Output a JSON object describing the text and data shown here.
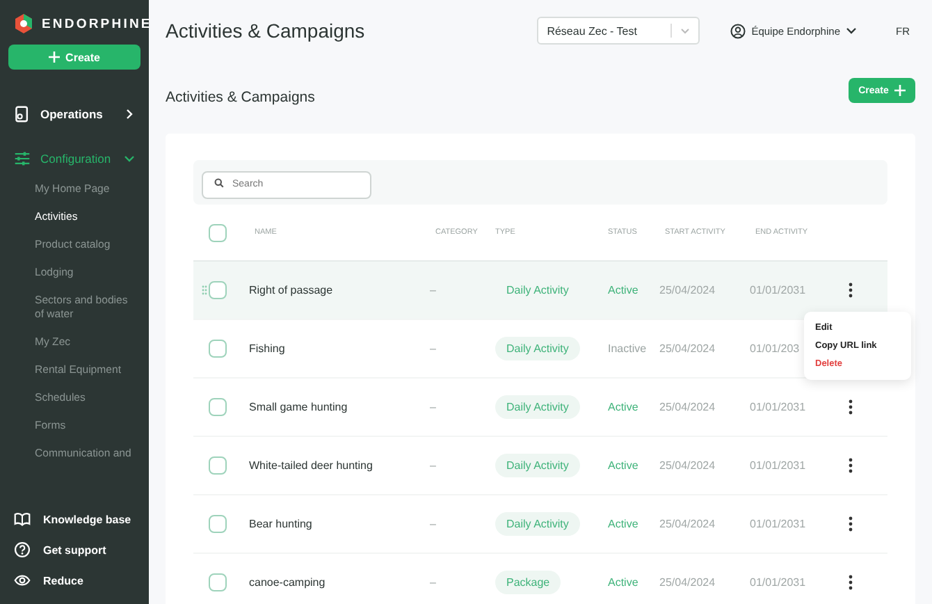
{
  "sidebar": {
    "brand": "ENDORPHINE",
    "create_button": "Create",
    "sections": [
      {
        "label": "Operations",
        "expanded": false
      },
      {
        "label": "Configuration",
        "expanded": true,
        "children": [
          {
            "label": "My Home Page",
            "selected": false
          },
          {
            "label": "Activities",
            "selected": true
          },
          {
            "label": "Product catalog",
            "selected": false
          },
          {
            "label": "Lodging",
            "selected": false
          },
          {
            "label": "Sectors and bodies of water",
            "selected": false
          },
          {
            "label": "My Zec",
            "selected": false
          },
          {
            "label": "Rental Equipment",
            "selected": false
          },
          {
            "label": "Schedules",
            "selected": false
          },
          {
            "label": "Forms",
            "selected": false
          },
          {
            "label": "Communication and",
            "selected": false
          }
        ]
      }
    ],
    "footer": [
      {
        "label": "Knowledge base"
      },
      {
        "label": "Get support"
      },
      {
        "label": "Reduce"
      }
    ]
  },
  "header": {
    "title": "Activities & Campaigns",
    "network_select": "Réseau Zec - Test",
    "user": "Équipe Endorphine",
    "language": "FR"
  },
  "page": {
    "title": "Activities & Campaigns",
    "create_button": "Create"
  },
  "table": {
    "search": {
      "placeholder": "Search"
    },
    "select_all": {
      "checked": false
    },
    "columns": [
      "NAME",
      "CATEGORY",
      "TYPE",
      "STATUS",
      "START ACTIVITY",
      "END ACTIVITY"
    ],
    "rows": [
      {
        "name": "Right of passage",
        "category": "–",
        "type": "Daily Activity",
        "status": "Active",
        "active": true,
        "start": "25/04/2024",
        "end": "01/01/2031",
        "selected": true,
        "checked": false
      },
      {
        "name": "Fishing",
        "category": "–",
        "type": "Daily Activity",
        "status": "Inactive",
        "active": false,
        "start": "25/04/2024",
        "end": "01/01/203",
        "selected": false,
        "checked": false
      },
      {
        "name": "Small game hunting",
        "category": "–",
        "type": "Daily Activity",
        "status": "Active",
        "active": true,
        "start": "25/04/2024",
        "end": "01/01/2031",
        "selected": false,
        "checked": false
      },
      {
        "name": "White-tailed deer hunting",
        "category": "–",
        "type": "Daily Activity",
        "status": "Active",
        "active": true,
        "start": "25/04/2024",
        "end": "01/01/2031",
        "selected": false,
        "checked": false
      },
      {
        "name": "Bear hunting",
        "category": "–",
        "type": "Daily Activity",
        "status": "Active",
        "active": true,
        "start": "25/04/2024",
        "end": "01/01/2031",
        "selected": false,
        "checked": false
      },
      {
        "name": "canoe-camping",
        "category": "–",
        "type": "Package",
        "status": "Active",
        "active": true,
        "start": "25/04/2024",
        "end": "01/01/2031",
        "selected": false,
        "checked": false
      }
    ],
    "context_menu": [
      {
        "label": "Edit",
        "kind": "normal"
      },
      {
        "label": "Copy URL link",
        "kind": "normal"
      },
      {
        "label": "Delete",
        "kind": "danger"
      }
    ]
  }
}
